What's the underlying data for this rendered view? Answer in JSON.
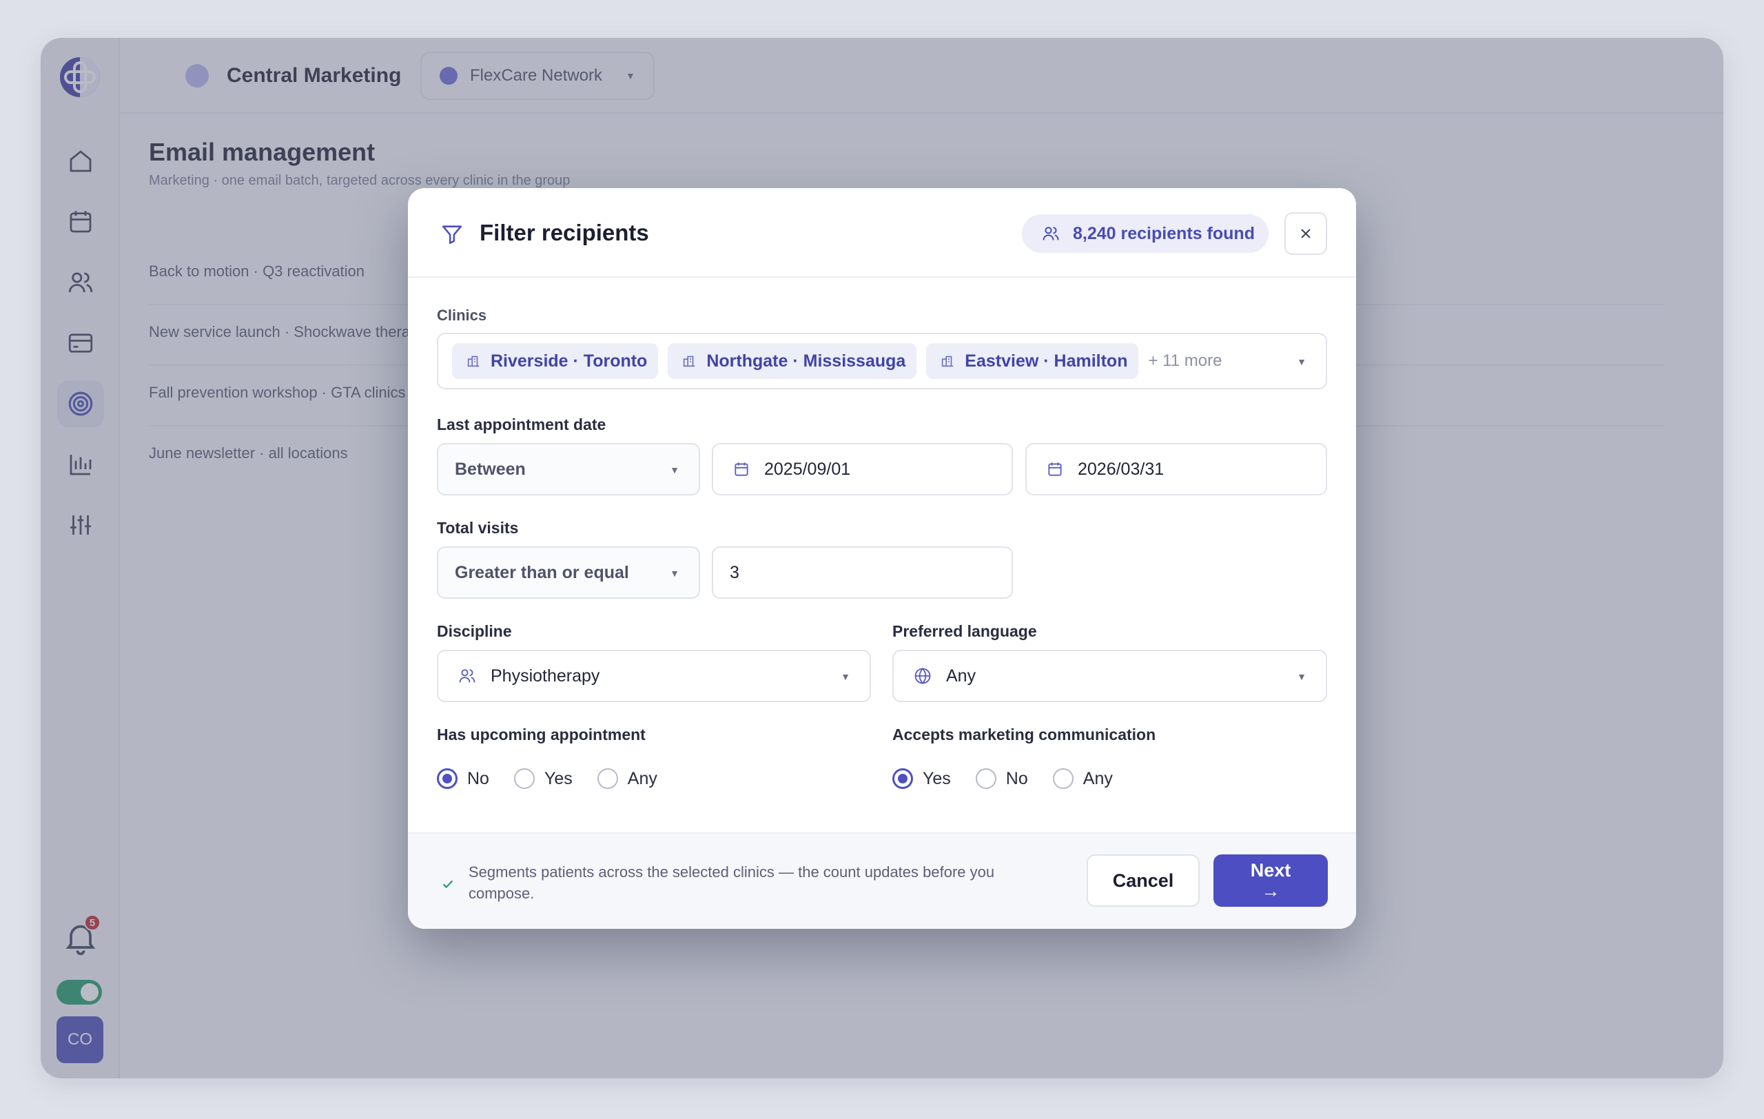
{
  "background": {
    "org_name": "Central Marketing",
    "network_name": "FlexCare Network",
    "page_title": "Email management",
    "page_subtitle": "Marketing · one email batch, targeted across every clinic in the group",
    "rows": [
      "Back to motion · Q3 reactivation",
      "New service launch · Shockwave therapy",
      "Fall prevention workshop · GTA clinics",
      "June newsletter · all locations"
    ],
    "notification_count": "5",
    "avatar_initials": "CO"
  },
  "modal": {
    "title": "Filter recipients",
    "recipient_count": "8,240 recipients found",
    "clinics": {
      "label": "Clinics",
      "chips": [
        "Riverside · Toronto",
        "Northgate · Mississauga",
        "Eastview · Hamilton"
      ],
      "more": "+ 11 more"
    },
    "last_appointment": {
      "label": "Last appointment date",
      "operator": "Between",
      "from": "2025/09/01",
      "to": "2026/03/31"
    },
    "total_visits": {
      "label": "Total visits",
      "operator": "Greater than or equal",
      "value": "3"
    },
    "discipline": {
      "label": "Discipline",
      "value": "Physiotherapy"
    },
    "language": {
      "label": "Preferred language",
      "value": "Any"
    },
    "upcoming": {
      "label": "Has upcoming appointment",
      "options": [
        "No",
        "Yes",
        "Any"
      ],
      "selected": "No"
    },
    "marketing": {
      "label": "Accepts marketing communication",
      "options": [
        "Yes",
        "No",
        "Any"
      ],
      "selected": "Yes"
    },
    "footer_note": "Segments patients across the selected clinics — the count updates before you compose.",
    "cancel_label": "Cancel",
    "next_label": "Next",
    "next_arrow": "→"
  },
  "colors": {
    "accent": "#4d4ec1",
    "toggle_on": "#1f9b6b",
    "badge": "#c3262a"
  }
}
